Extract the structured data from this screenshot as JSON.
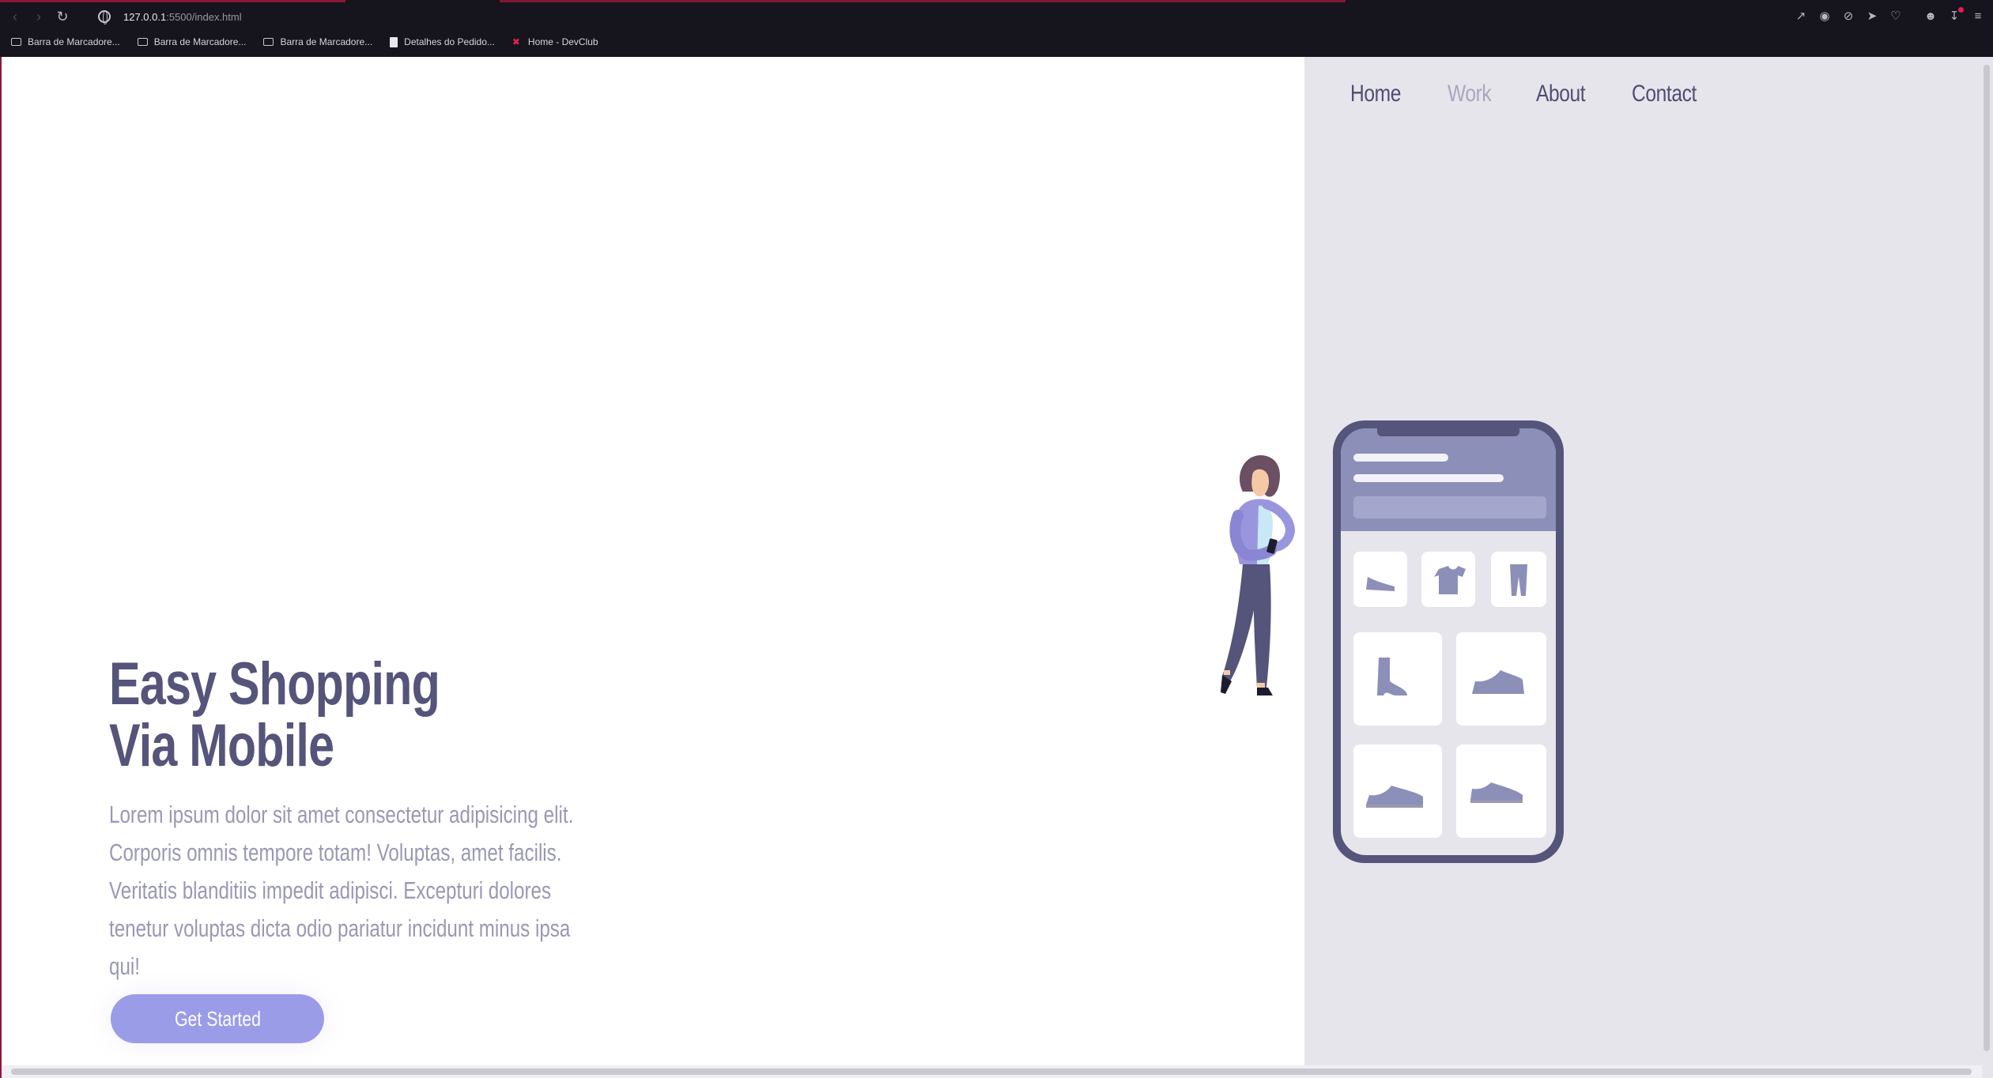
{
  "browser": {
    "url_host": "127.0.0.1",
    "url_rest": ":5500/index.html",
    "bookmarks": [
      {
        "label": "Barra de Marcadore...",
        "icon": "folder-icon"
      },
      {
        "label": "Barra de Marcadore...",
        "icon": "folder-icon"
      },
      {
        "label": "Barra de Marcadore...",
        "icon": "folder-icon"
      },
      {
        "label": "Detalhes do Pedido...",
        "icon": "document-icon"
      },
      {
        "label": "Home - DevClub",
        "icon": "devclub-icon"
      }
    ]
  },
  "nav": {
    "items": [
      {
        "label": "Home"
      },
      {
        "label": "Work"
      },
      {
        "label": "About"
      },
      {
        "label": "Contact"
      }
    ],
    "active": "Work"
  },
  "hero": {
    "title_line1": "Easy Shopping",
    "title_line2": "Via Mobile",
    "text": "Lorem ipsum dolor sit amet consectetur adipisicing elit. Corporis omnis tempore totam! Voluptas, amet facilis. Veritatis blanditiis impedit adipisci. Excepturi dolores tenetur voluptas dicta odio pariatur incidunt minus ipsa qui!",
    "cta_label": "Get Started"
  },
  "colors": {
    "accent": "#9b9ce8",
    "heading": "#55547a",
    "panel": "#e6e5ec",
    "phone": "#55547a"
  }
}
